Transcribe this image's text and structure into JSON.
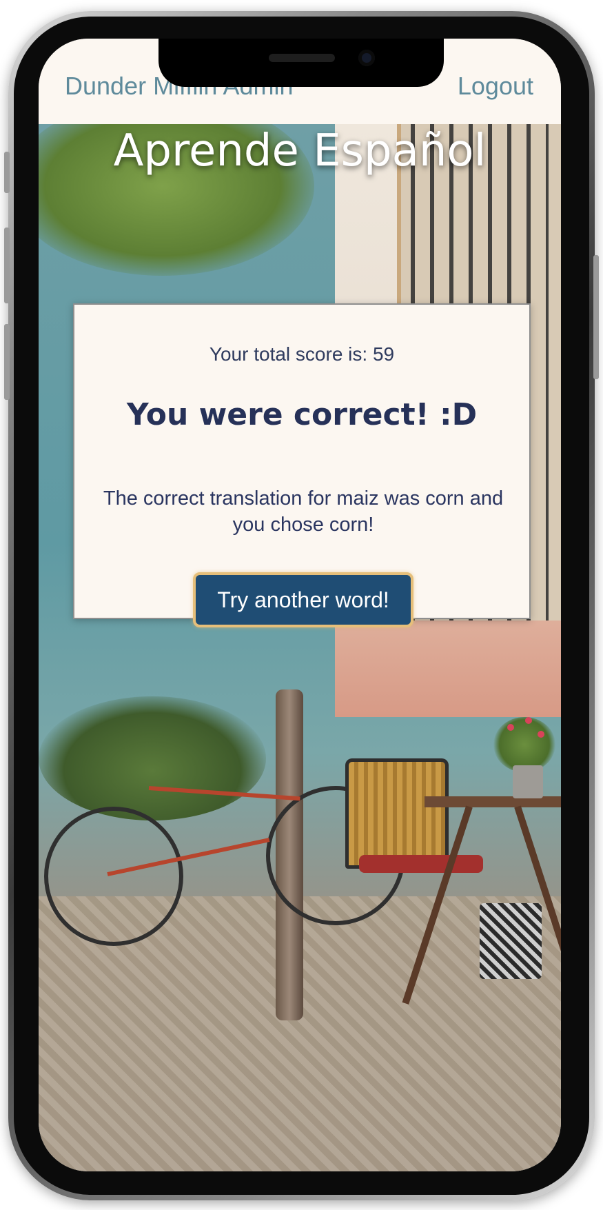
{
  "navbar": {
    "brand": "Dunder Mifflin Admin",
    "logout": "Logout"
  },
  "hero": {
    "title": "Aprende Español"
  },
  "result_card": {
    "score_text": "Your total score is: 59",
    "heading": "You were correct! :D",
    "feedback": "The correct translation for maiz was corn and you chose corn!",
    "button_label": "Try another word!"
  },
  "colors": {
    "nav_link": "#5e8a9b",
    "card_bg": "#fcf7f1",
    "heading_text": "#263158",
    "button_bg": "#1f4d74",
    "button_border": "#e6bf7a"
  },
  "icons": {
    "background": "street-scene-image"
  }
}
